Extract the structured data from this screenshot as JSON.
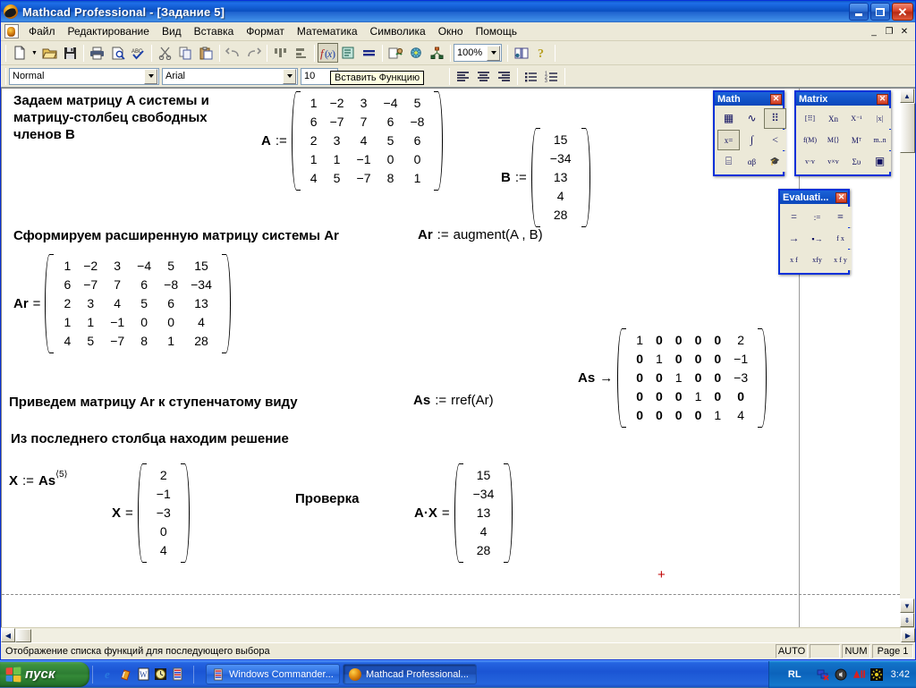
{
  "window": {
    "title": "Mathcad Professional - [Задание  5]",
    "logo_icon": "mathcad-logo-icon",
    "minimize_label": "_",
    "restore_label": "❐",
    "close_label": "✕"
  },
  "menu": {
    "doc_icon": "document-icon",
    "items": [
      {
        "label": "Файл"
      },
      {
        "label": "Редактирование"
      },
      {
        "label": "Вид"
      },
      {
        "label": "Вставка"
      },
      {
        "label": "Формат"
      },
      {
        "label": "Математика"
      },
      {
        "label": "Символика"
      },
      {
        "label": "Окно"
      },
      {
        "label": "Помощь"
      }
    ],
    "mdi_minimize": "_",
    "mdi_restore": "❐",
    "mdi_close": "✕"
  },
  "toolbar_main": {
    "buttons": [
      {
        "name": "new-document-button",
        "icon": "new-file-icon"
      },
      {
        "name": "new-document-dropdown",
        "icon": "chevron-down-icon"
      },
      {
        "name": "open-button",
        "icon": "folder-open-icon"
      },
      {
        "name": "save-button",
        "icon": "floppy-disk-icon"
      },
      {
        "name": "print-button",
        "icon": "printer-icon"
      },
      {
        "name": "print-preview-button",
        "icon": "print-preview-icon"
      },
      {
        "name": "spell-check-button",
        "icon": "abc-check-icon"
      },
      {
        "name": "cut-button",
        "icon": "scissors-icon"
      },
      {
        "name": "copy-button",
        "icon": "copy-icon"
      },
      {
        "name": "paste-button",
        "icon": "clipboard-paste-icon"
      },
      {
        "name": "undo-button",
        "icon": "undo-arrow-icon"
      },
      {
        "name": "redo-button",
        "icon": "redo-arrow-icon"
      },
      {
        "name": "align-across-button",
        "icon": "align-regions-horizontal-icon"
      },
      {
        "name": "align-down-button",
        "icon": "align-regions-vertical-icon"
      },
      {
        "name": "insert-function-button",
        "icon": "f-of-x-icon"
      },
      {
        "name": "insert-unit-button",
        "icon": "insert-unit-icon"
      },
      {
        "name": "calculate-button",
        "icon": "equals-icon"
      },
      {
        "name": "insert-hyperlink-button",
        "icon": "hyperlink-icon"
      },
      {
        "name": "insert-component-button",
        "icon": "component-icon"
      },
      {
        "name": "run-button",
        "icon": "resource-tree-icon"
      },
      {
        "name": "resource-center-button",
        "icon": "book-icon"
      },
      {
        "name": "help-button",
        "icon": "question-mark-icon"
      }
    ],
    "zoom_value": "100%",
    "tooltip": "Вставить Функцию"
  },
  "toolbar_format": {
    "style_value": "Normal",
    "font_value": "Arial",
    "size_value": "10",
    "buttons": [
      {
        "name": "align-left-button",
        "icon": "align-left-icon"
      },
      {
        "name": "align-center-button",
        "icon": "align-center-icon"
      },
      {
        "name": "align-right-button",
        "icon": "align-right-icon"
      },
      {
        "name": "bullet-list-button",
        "icon": "bullet-list-icon"
      },
      {
        "name": "numbered-list-button",
        "icon": "numbered-list-icon"
      }
    ]
  },
  "document": {
    "text_1": {
      "line1": "Задаем матрицу A системы и",
      "line2": "матрицу-столбец свободных",
      "line3": "членов B"
    },
    "eq_A": {
      "label": "A",
      "op": ":="
    },
    "matrix_A": [
      [
        "1",
        "−2",
        "3",
        "−4",
        "5"
      ],
      [
        "6",
        "−7",
        "7",
        "6",
        "−8"
      ],
      [
        "2",
        "3",
        "4",
        "5",
        "6"
      ],
      [
        "1",
        "1",
        "−1",
        "0",
        "0"
      ],
      [
        "4",
        "5",
        "−7",
        "8",
        "1"
      ]
    ],
    "eq_B": {
      "label": "B",
      "op": ":="
    },
    "matrix_B": [
      [
        "15"
      ],
      [
        "−34"
      ],
      [
        "13"
      ],
      [
        "4"
      ],
      [
        "28"
      ]
    ],
    "text_2": "Сформируем расширенную матрицу системы Ar",
    "eq_Ar_def": {
      "label": "Ar",
      "op": ":=",
      "expr": "augment(A , B)"
    },
    "eq_Ar_show": {
      "label": "Ar",
      "op": "="
    },
    "matrix_Ar": [
      [
        "1",
        "−2",
        "3",
        "−4",
        "5",
        "15"
      ],
      [
        "6",
        "−7",
        "7",
        "6",
        "−8",
        "−34"
      ],
      [
        "2",
        "3",
        "4",
        "5",
        "6",
        "13"
      ],
      [
        "1",
        "1",
        "−1",
        "0",
        "0",
        "4"
      ],
      [
        "4",
        "5",
        "−7",
        "8",
        "1",
        "28"
      ]
    ],
    "text_3": "Приведем матрицу Ar к ступенчатому виду",
    "eq_As_def": {
      "label": "As",
      "op": ":=",
      "expr": "rref(Ar)"
    },
    "eq_As_show": {
      "label": "As",
      "op": "→"
    },
    "matrix_As": [
      [
        "1",
        "0",
        "0",
        "0",
        "0",
        "2"
      ],
      [
        "0",
        "1",
        "0",
        "0",
        "0",
        "−1"
      ],
      [
        "0",
        "0",
        "1",
        "0",
        "0",
        "−3"
      ],
      [
        "0",
        "0",
        "0",
        "1",
        "0",
        "0"
      ],
      [
        "0",
        "0",
        "0",
        "0",
        "1",
        "4"
      ]
    ],
    "matrix_As_bold": [
      [
        false,
        true,
        true,
        true,
        true,
        false
      ],
      [
        true,
        false,
        true,
        true,
        true,
        false
      ],
      [
        true,
        true,
        false,
        true,
        true,
        false
      ],
      [
        true,
        true,
        true,
        false,
        true,
        true
      ],
      [
        true,
        true,
        true,
        true,
        false,
        false
      ]
    ],
    "text_4": "Из последнего столбца находим решение",
    "eq_X_def": {
      "label": "X",
      "op": ":=",
      "base": "As",
      "superscript": "⟨5⟩"
    },
    "eq_X_show": {
      "label": "X",
      "op": "="
    },
    "matrix_X": [
      [
        "2"
      ],
      [
        "−1"
      ],
      [
        "−3"
      ],
      [
        "0"
      ],
      [
        "4"
      ]
    ],
    "text_5": "Проверка",
    "eq_AX": {
      "label": "A·X",
      "op": "="
    },
    "matrix_AX": [
      [
        "15"
      ],
      [
        "−34"
      ],
      [
        "13"
      ],
      [
        "4"
      ],
      [
        "28"
      ]
    ],
    "cursor_marker": "+"
  },
  "palettes": [
    {
      "name": "math-palette",
      "title": "Math",
      "close_label": "✕",
      "cols": 3,
      "buttons": [
        {
          "name": "calculator-toolbar-button",
          "icon": "calculator-icon",
          "glyph": "▦"
        },
        {
          "name": "graph-toolbar-button",
          "icon": "graph-icon",
          "glyph": "∿"
        },
        {
          "name": "matrix-toolbar-button",
          "icon": "matrix-icon",
          "glyph": "⠿",
          "selected": true
        },
        {
          "name": "evaluation-toolbar-button",
          "icon": "evaluation-icon",
          "glyph": "x=",
          "selected": true
        },
        {
          "name": "calculus-toolbar-button",
          "icon": "calculus-icon",
          "glyph": "∫"
        },
        {
          "name": "boolean-toolbar-button",
          "icon": "boolean-icon",
          "glyph": "<"
        },
        {
          "name": "programming-toolbar-button",
          "icon": "programming-icon",
          "glyph": "⌸"
        },
        {
          "name": "greek-toolbar-button",
          "icon": "greek-alpha-beta-icon",
          "glyph": "αβ"
        },
        {
          "name": "symbolic-toolbar-button",
          "icon": "symbolic-keyword-icon",
          "glyph": "🎓"
        }
      ]
    },
    {
      "name": "matrix-palette",
      "title": "Matrix",
      "close_label": "✕",
      "cols": 4,
      "buttons": [
        {
          "name": "insert-matrix-button",
          "icon": "matrix-grid-icon",
          "glyph": "[⠿]"
        },
        {
          "name": "matrix-subscript-button",
          "icon": "x-subscript-n-icon",
          "glyph": "Xn"
        },
        {
          "name": "matrix-inverse-button",
          "icon": "x-inverse-icon",
          "glyph": "X⁻¹"
        },
        {
          "name": "determinant-button",
          "icon": "absolute-value-icon",
          "glyph": "|x|"
        },
        {
          "name": "vectorize-button",
          "icon": "vectorize-icon",
          "glyph": "f(M)"
        },
        {
          "name": "matrix-column-button",
          "icon": "matrix-column-icon",
          "glyph": "M⟨⟩"
        },
        {
          "name": "matrix-transpose-button",
          "icon": "matrix-transpose-icon",
          "glyph": "Mᵀ"
        },
        {
          "name": "range-variable-button",
          "icon": "range-variable-icon",
          "glyph": "m..n"
        },
        {
          "name": "dot-product-button",
          "icon": "dot-product-icon",
          "glyph": "v·v"
        },
        {
          "name": "cross-product-button",
          "icon": "cross-product-icon",
          "glyph": "v×v"
        },
        {
          "name": "vector-sum-button",
          "icon": "sigma-sum-icon",
          "glyph": "Συ"
        },
        {
          "name": "picture-button",
          "icon": "picture-icon",
          "glyph": "▣"
        }
      ]
    },
    {
      "name": "evaluation-palette",
      "title": "Evaluati...",
      "close_label": "✕",
      "cols": 3,
      "buttons": [
        {
          "name": "equal-button",
          "icon": "equals-icon",
          "glyph": "="
        },
        {
          "name": "definition-button",
          "icon": "colon-equals-icon",
          "glyph": ":="
        },
        {
          "name": "global-definition-button",
          "icon": "triple-bar-icon",
          "glyph": "≡"
        },
        {
          "name": "symbolic-eval-button",
          "icon": "right-arrow-icon",
          "glyph": "→"
        },
        {
          "name": "symbolic-keyword-eval-button",
          "icon": "box-right-arrow-icon",
          "glyph": "▪→"
        },
        {
          "name": "function-value-button",
          "icon": "f-x-icon",
          "glyph": "f x"
        },
        {
          "name": "prefix-operator-button",
          "icon": "prefix-operator-icon",
          "glyph": "x f"
        },
        {
          "name": "infix-operator-button",
          "icon": "infix-operator-icon",
          "glyph": "xfy"
        },
        {
          "name": "treefix-operator-button",
          "icon": "treefix-operator-icon",
          "glyph": "x f y"
        }
      ]
    }
  ],
  "status_bar": {
    "message": "Отображение списка функций для последующего выбора",
    "auto": "AUTO",
    "blank": "",
    "num": "NUM",
    "page": "Page 1"
  },
  "taskbar": {
    "start_label": "пуск",
    "start_icon": "windows-flag-icon",
    "quick_launch": [
      {
        "name": "internet-explorer-quicklaunch",
        "icon": "internet-explorer-icon",
        "glyph": "e"
      },
      {
        "name": "show-desktop-quicklaunch",
        "icon": "show-desktop-icon",
        "glyph": "✎"
      },
      {
        "name": "word-quicklaunch",
        "icon": "word-icon",
        "glyph": "W"
      },
      {
        "name": "clock-quicklaunch",
        "icon": "clock-icon",
        "glyph": "◷"
      },
      {
        "name": "commander-quicklaunch",
        "icon": "windows-commander-icon",
        "glyph": "▤"
      }
    ],
    "tasks": [
      {
        "name": "taskbar-item-commander",
        "label": "Windows Commander...",
        "icon": "windows-commander-icon",
        "active": false
      },
      {
        "name": "taskbar-item-mathcad",
        "label": "Mathcad Professional...",
        "icon": "mathcad-logo-icon",
        "active": true
      }
    ],
    "language": "RL",
    "tray_icons": [
      {
        "name": "network-disconnected-tray-icon",
        "icon": "network-icon"
      },
      {
        "name": "volume-tray-icon",
        "icon": "speaker-icon"
      },
      {
        "name": "ati-tray-icon",
        "icon": "ati-logo-icon"
      },
      {
        "name": "display-tray-icon",
        "icon": "display-settings-icon"
      }
    ],
    "clock": "3:42"
  },
  "colors": {
    "title_blue": "#0a4fc0",
    "chrome": "#ece9d8",
    "palette_border": "#0831d9",
    "close_red": "#cf3a20",
    "cursor_red": "#c00000",
    "taskbar_blue": "#2463e0",
    "start_green": "#3d9140"
  }
}
